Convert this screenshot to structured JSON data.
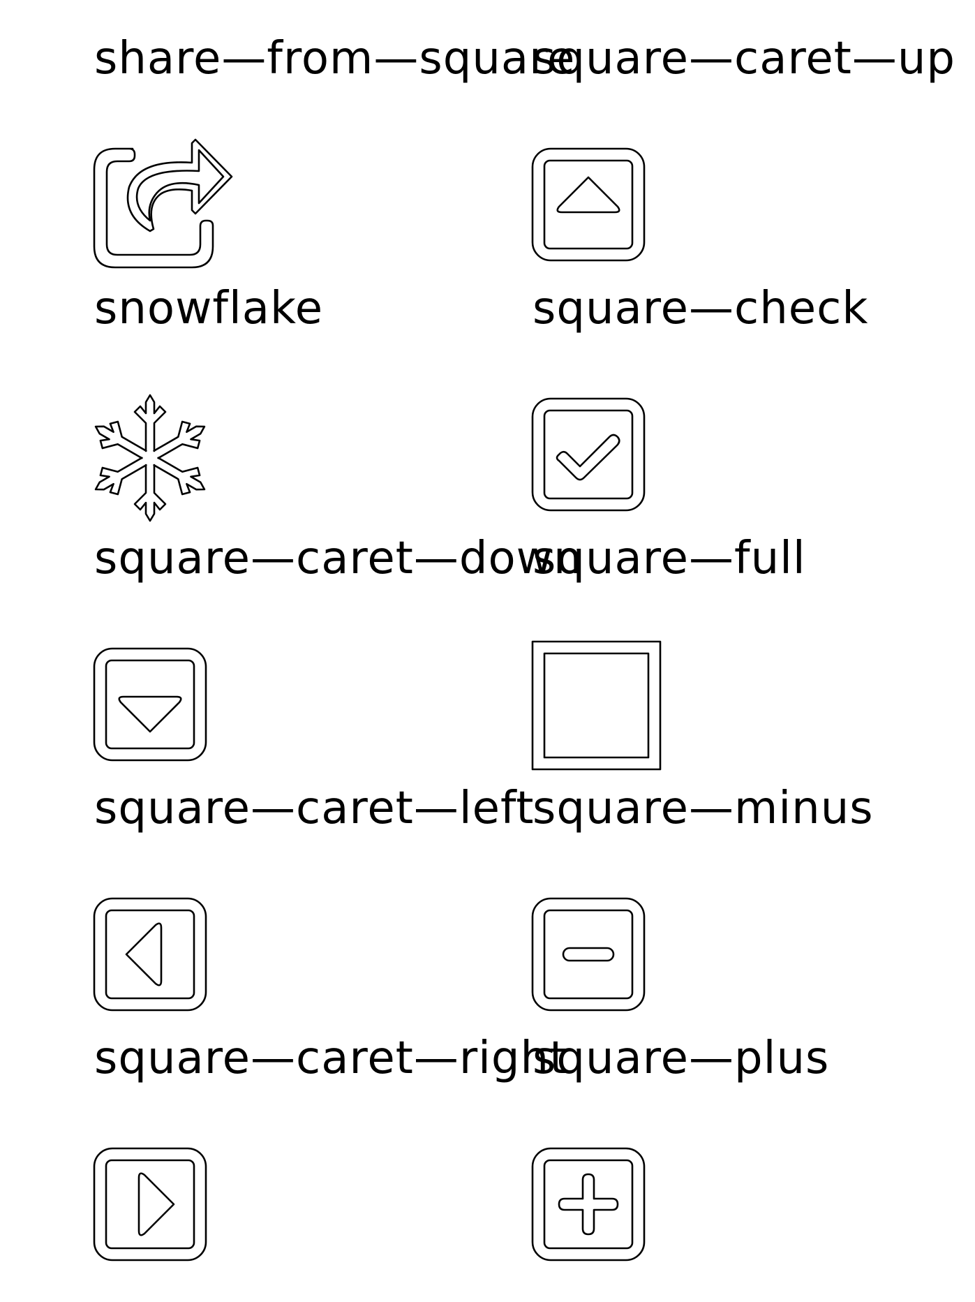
{
  "icons": [
    {
      "label": "share—from—square",
      "icon": "share-from-square-icon"
    },
    {
      "label": "square—caret—up",
      "icon": "square-caret-up-icon"
    },
    {
      "label": "snowflake",
      "icon": "snowflake-icon"
    },
    {
      "label": "square—check",
      "icon": "square-check-icon"
    },
    {
      "label": "square—caret—down",
      "icon": "square-caret-down-icon"
    },
    {
      "label": "square—full",
      "icon": "square-full-icon"
    },
    {
      "label": "square—caret—left",
      "icon": "square-caret-left-icon"
    },
    {
      "label": "square—minus",
      "icon": "square-minus-icon"
    },
    {
      "label": "square—caret—right",
      "icon": "square-caret-right-icon"
    },
    {
      "label": "square—plus",
      "icon": "square-plus-icon"
    }
  ]
}
